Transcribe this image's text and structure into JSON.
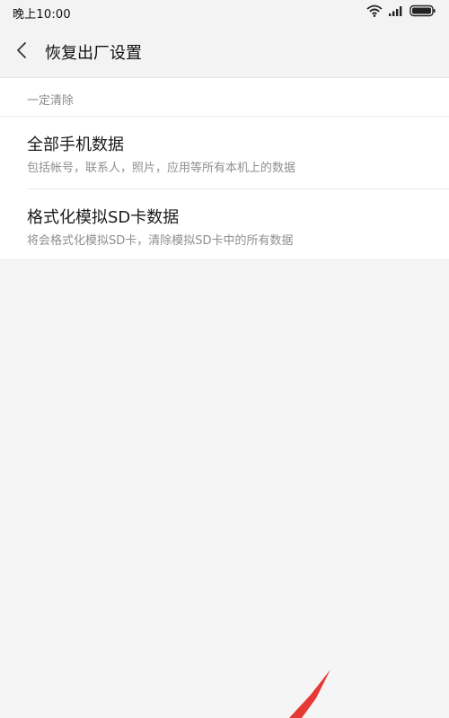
{
  "status_bar": {
    "time": "晚上10:00"
  },
  "header": {
    "title": "恢复出厂设置",
    "back_icon": "chevron-left-icon"
  },
  "section": {
    "header": "一定清除",
    "items": [
      {
        "title": "全部手机数据",
        "subtitle": "包括帐号，联系人，照片，应用等所有本机上的数据"
      },
      {
        "title": "格式化模拟SD卡数据",
        "subtitle": "将会格式化模拟SD卡，清除模拟SD卡中的所有数据"
      }
    ]
  },
  "colors": {
    "background": "#f5f5f5",
    "card": "#ffffff",
    "annotation_arrow": "#e53935"
  }
}
